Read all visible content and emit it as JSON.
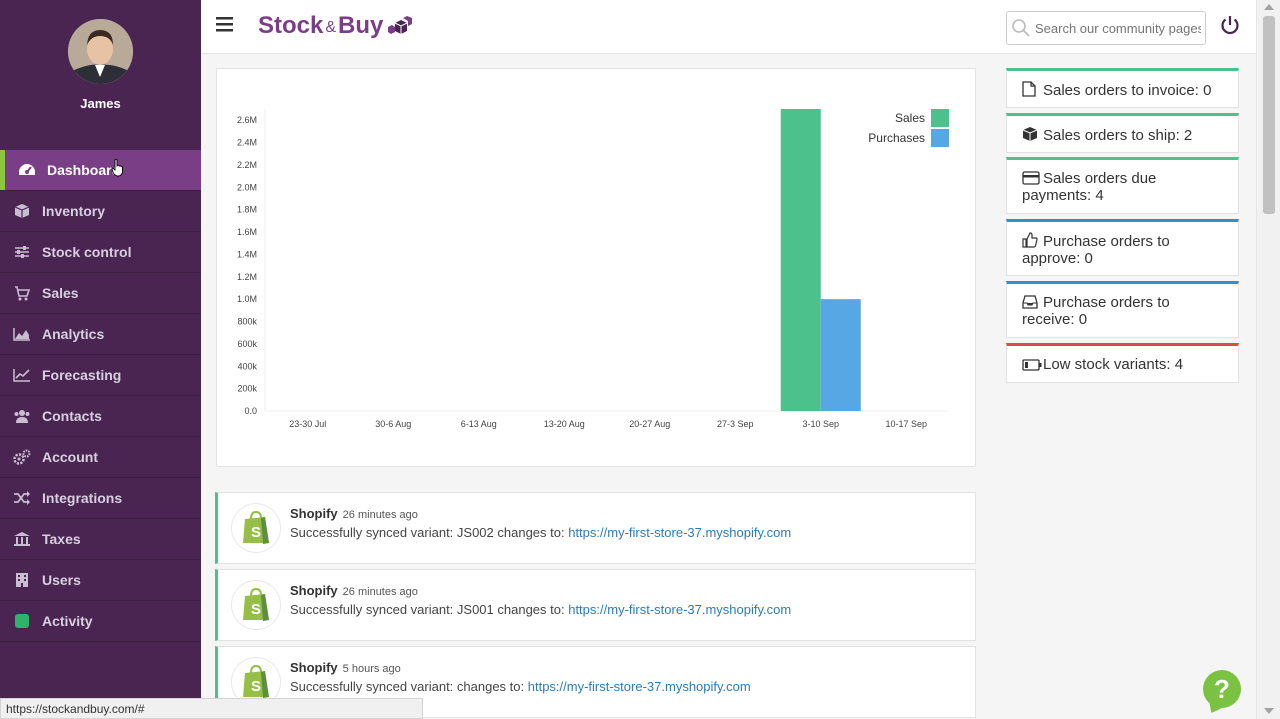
{
  "sidebar": {
    "user_name": "James",
    "items": [
      {
        "label": "Dashboard",
        "icon": "dashboard-icon",
        "active": true
      },
      {
        "label": "Inventory",
        "icon": "cube-icon"
      },
      {
        "label": "Stock control",
        "icon": "sliders-icon"
      },
      {
        "label": "Sales",
        "icon": "cart-icon"
      },
      {
        "label": "Analytics",
        "icon": "area-chart-icon"
      },
      {
        "label": "Forecasting",
        "icon": "line-chart-icon"
      },
      {
        "label": "Contacts",
        "icon": "users-icon"
      },
      {
        "label": "Account",
        "icon": "gears-icon"
      },
      {
        "label": "Integrations",
        "icon": "shuffle-icon"
      },
      {
        "label": "Taxes",
        "icon": "bank-icon"
      },
      {
        "label": "Users",
        "icon": "building-icon"
      },
      {
        "label": "Activity",
        "icon": "activity-square-icon"
      }
    ]
  },
  "header": {
    "logo_part1": "Stock",
    "logo_amp": "&",
    "logo_part2": "Buy",
    "search_placeholder": "Search our community pages"
  },
  "chart_data": {
    "type": "bar",
    "categories": [
      "23-30 Jul",
      "30-6 Aug",
      "6-13 Aug",
      "13-20 Aug",
      "20-27 Aug",
      "27-3 Sep",
      "3-10 Sep",
      "10-17 Sep"
    ],
    "series": [
      {
        "name": "Sales",
        "color": "#4cc18b",
        "values": [
          0,
          0,
          0,
          0,
          0,
          0,
          2700000,
          0
        ]
      },
      {
        "name": "Purchases",
        "color": "#56a7e3",
        "values": [
          0,
          0,
          0,
          0,
          0,
          0,
          1000000,
          0
        ]
      }
    ],
    "yticks": [
      "0.0",
      "200k",
      "400k",
      "600k",
      "800k",
      "1.0M",
      "1.2M",
      "1.4M",
      "1.6M",
      "1.8M",
      "2.0M",
      "2.2M",
      "2.4M",
      "2.6M"
    ],
    "ylim": [
      0,
      2700000
    ],
    "legend": "top-right"
  },
  "feed": [
    {
      "source": "Shopify",
      "time": "26 minutes ago",
      "message": "Successfully synced variant: JS002 changes to: ",
      "link": "https://my-first-store-37.myshopify.com"
    },
    {
      "source": "Shopify",
      "time": "26 minutes ago",
      "message": "Successfully synced variant: JS001 changes to: ",
      "link": "https://my-first-store-37.myshopify.com"
    },
    {
      "source": "Shopify",
      "time": "5 hours ago",
      "message": "Successfully synced variant: changes to: ",
      "link": "https://my-first-store-37.myshopify.com"
    }
  ],
  "stats": [
    {
      "label": "Sales orders to invoice: 0",
      "color": "#4cc18b"
    },
    {
      "label": "Sales orders to ship: 2",
      "color": "#4cc18b"
    },
    {
      "label": "Sales orders due payments: 4",
      "color": "#4cc18b"
    },
    {
      "label": "Purchase orders to approve: 0",
      "color": "#2e8fd6"
    },
    {
      "label": "Purchase orders to receive: 0",
      "color": "#2e8fd6"
    },
    {
      "label": "Low stock variants: 4",
      "color": "#e04a3f"
    }
  ],
  "status_url": "https://stockandbuy.com/#",
  "help_label": "?"
}
